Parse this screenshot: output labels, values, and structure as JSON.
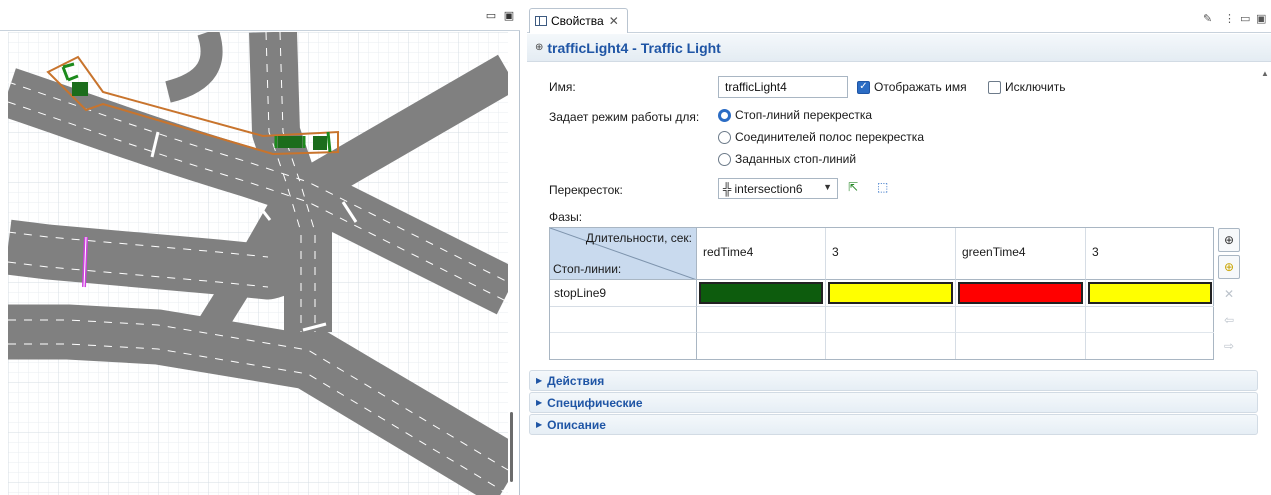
{
  "left_panel": {
    "minimize_glyph": "▭",
    "maximize_glyph": "▣"
  },
  "properties_tab": {
    "label": "Свойства",
    "close_glyph": "✕"
  },
  "toolbar_glyphs": {
    "edit": "✎",
    "menu": "⋮",
    "minimize": "▭",
    "maximize": "▣"
  },
  "title": {
    "icon_glyph": "⊕",
    "text": "trafficLight4 - Traffic Light"
  },
  "form": {
    "name_label": "Имя:",
    "name_value": "trafficLight4",
    "show_name_label": "Отображать имя",
    "show_name_checked": true,
    "exclude_label": "Исключить",
    "exclude_checked": false,
    "mode_label": "Задает режим работы для:",
    "radio_options": [
      "Стоп-линий перекрестка",
      "Соединителей полос перекрестка",
      "Заданных стоп-линий"
    ],
    "selected_radio": 0,
    "intersection_label": "Перекресток:",
    "intersection_value": "intersection6",
    "phases_label": "Фазы:"
  },
  "phases_table": {
    "header_top": "Длительности, сек:",
    "header_bottom": "Стоп-линии:",
    "columns": [
      "redTime4",
      "3",
      "greenTime4",
      "3"
    ],
    "rows": [
      {
        "label": "stopLine9",
        "colors": [
          "#0d5c0d",
          "#ffff00",
          "#ff0000",
          "#ffff00"
        ]
      }
    ]
  },
  "side_buttons": [
    "add-icon",
    "add-highlight-icon",
    "delete-icon",
    "move-left-icon",
    "move-right-icon"
  ],
  "sections": [
    "Действия",
    "Специфические",
    "Описание"
  ],
  "colors": {
    "accent": "#1f55a5",
    "checkbox": "#2b6cc4",
    "road": "#7a7a7a",
    "selection": "#c8742d",
    "stopline": "#1c8a1c"
  }
}
